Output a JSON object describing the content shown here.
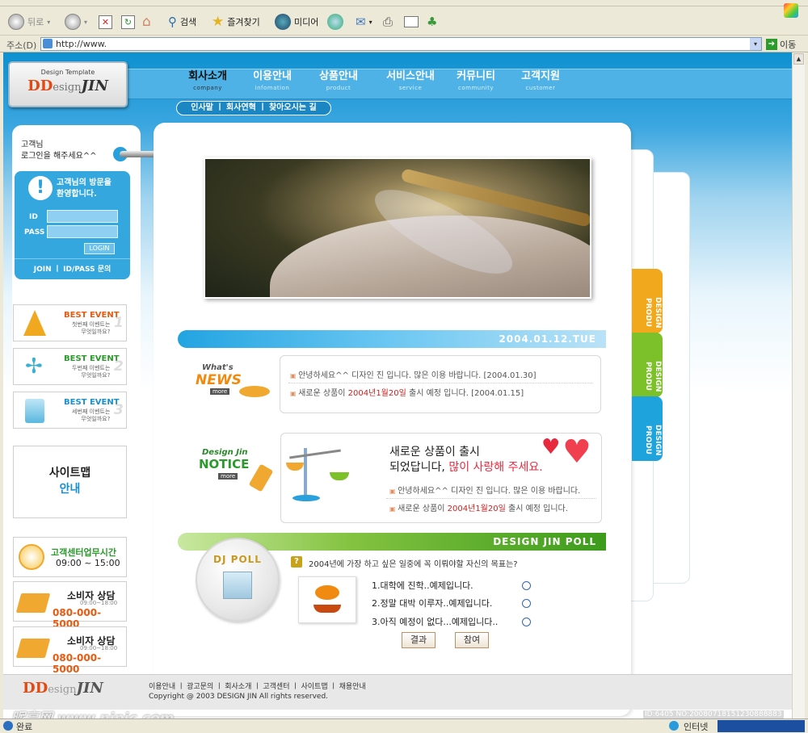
{
  "browser": {
    "toolbar": {
      "back": "뒤로",
      "search": "검색",
      "favorites": "즐겨찾기",
      "media": "미디어"
    },
    "address": {
      "label": "주소(D)",
      "value": "http://www.",
      "go": "이동"
    },
    "status": {
      "left": "완료",
      "right": "인터넷"
    }
  },
  "site": {
    "logo": {
      "small": "Design Template",
      "brand_prefix": "DD",
      "brand_word": "esign",
      "brand_suffix": "JIN"
    },
    "nav": [
      {
        "label": "회사소개",
        "sub": "company"
      },
      {
        "label": "이용안내",
        "sub": "infomation"
      },
      {
        "label": "상품안내",
        "sub": "product"
      },
      {
        "label": "서비스안내",
        "sub": "service"
      },
      {
        "label": "커뮤니티",
        "sub": "community"
      },
      {
        "label": "고객지원",
        "sub": "customer"
      }
    ],
    "subnav": "인사말 ㅣ 회사연혁 ㅣ 찾아오시는 길",
    "login": {
      "greeting1": "고객님",
      "greeting2": "로그인을 해주세요^^",
      "welcome1": "고객님의 방문을",
      "welcome2": "환영합니다.",
      "id_label": "ID",
      "pass_label": "PASS",
      "login_btn": "LOGIN",
      "join": "JOIN ㅣ ID/PASS 문의"
    },
    "events": [
      {
        "title": "BEST EVENT",
        "line1": "첫번째 이벤트는",
        "line2": "무엇일까요?",
        "num": "1"
      },
      {
        "title": "BEST EVENT",
        "line1": "두번째 이벤트는",
        "line2": "무엇일까요?",
        "num": "2"
      },
      {
        "title": "BEST EVENT",
        "line1": "세번째 이벤트는",
        "line2": "무엇일까요?",
        "num": "3"
      }
    ],
    "sitemap": {
      "line1": "사이트맵",
      "line2": "안내"
    },
    "hours": {
      "title": "고객센터업무시간",
      "time": "09:00 ~ 15:00"
    },
    "consult": [
      {
        "title": "소비자 상담",
        "time": "09:00~18:00",
        "phone": "080-000-5000"
      },
      {
        "title": "소비자 상담",
        "time": "09:00~18:00",
        "phone": "080-000-5000"
      }
    ],
    "date": "2004.01.12.TUE",
    "news": {
      "label1": "What's",
      "label2": "NEWS",
      "more": "more",
      "items": [
        {
          "pre": "안녕하세요^^ 디자인 진 입니다. 많은 이용 바랍니다.",
          "hi": "",
          "post": "[2004.01.30]"
        },
        {
          "pre": "새로운 상품이 ",
          "hi": "2004년1월20일",
          "post": " 출시 예정 입니다. [2004.01.15]"
        }
      ]
    },
    "notice": {
      "label1": "Design Jin",
      "label2": "NOTICE",
      "more": "more",
      "headline1": "새로운 상품이 출시",
      "headline2a": "되었답니다, ",
      "headline2b": "많이 사랑해 주세요.",
      "items": [
        {
          "pre": "안녕하세요^^ 디자인 진 입니다. 많은 이용 바랍니다.",
          "hi": "",
          "post": ""
        },
        {
          "pre": "새로운 상품이 ",
          "hi": "2004년1월20일",
          "post": " 출시 예정 입니다."
        }
      ]
    },
    "poll": {
      "bar": "DESIGN JIN  POLL",
      "badge": "DJ POLL",
      "question": "2004년에 가장 하고 싶은 일중에 꼭 이뤄야할 자신의 목표는?",
      "options": [
        "1.대학에 진학..예제입니다.",
        "2.정말 대박 이루자..예제입니다.",
        "3.아직 예정이 없다...예제입니다.."
      ],
      "result": "결과",
      "vote": "참여"
    },
    "side_tabs": [
      {
        "label": "DESIGN PRODU",
        "color": "#f2a81d"
      },
      {
        "label": "DESIGN PRODU",
        "color": "#7cc02a"
      },
      {
        "label": "DESIGN PRODU",
        "color": "#1fa3dc"
      }
    ],
    "footer": {
      "links": "이용안내 ㅣ 광고문의 ㅣ 회사소개 ㅣ 고객센터 ㅣ 사이트맵 ㅣ 채용안내",
      "copyright": "Copyright @ 2003 DESIGN JIN  All rights reserved."
    },
    "watermark": "昵享网 www.nipic.com",
    "image_id": "ID:6405 NO:20080718151230888883"
  }
}
